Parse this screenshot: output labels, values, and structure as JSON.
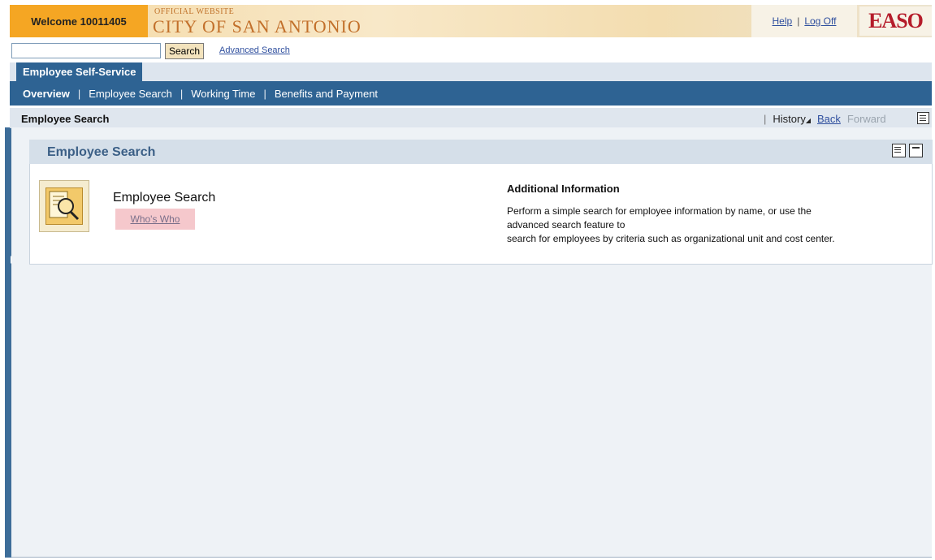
{
  "header": {
    "welcome": "Welcome 10011405",
    "logo_small": "OFFICIAL WEBSITE",
    "logo_main": "CITY OF SAN ANTONIO",
    "help": "Help",
    "pipe": "|",
    "logoff": "Log Off",
    "easo": "EASO"
  },
  "search": {
    "value": "",
    "button": "Search",
    "advanced": "Advanced Search"
  },
  "tabs": {
    "active": "Employee Self-Service"
  },
  "subnav": {
    "items": [
      "Overview",
      "Employee Search",
      "Working Time",
      "Benefits and Payment"
    ],
    "pipe": "|"
  },
  "titlebar": {
    "title": "Employee Search",
    "pipe": "|",
    "history": "History",
    "back": "Back",
    "forward": "Forward"
  },
  "panel": {
    "title": "Employee Search",
    "service_title": "Employee Search",
    "link": "Who's Who",
    "info_title": "Additional Information",
    "info_lines": [
      "Perform a simple search for employee information by name, or use the",
      "advanced search feature to",
      "search for employees by criteria such as organizational unit and cost center."
    ]
  },
  "colors": {
    "accent": "#2e6393",
    "welcome_bg": "#f5a623",
    "brand_orange": "#c2702b",
    "easo_red": "#b51c2a"
  }
}
